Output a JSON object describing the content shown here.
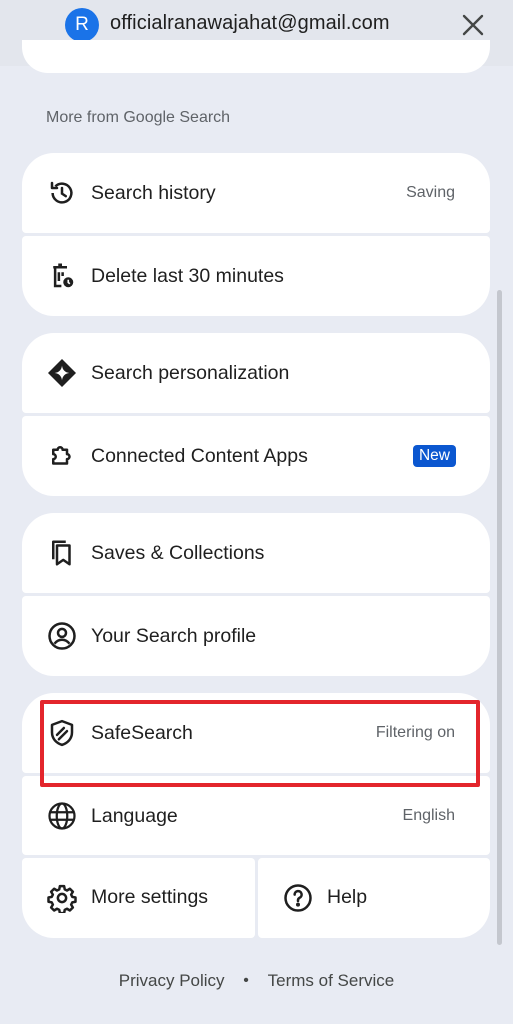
{
  "account": {
    "avatar_letter": "R",
    "email": "officialranawajahat@gmail.com"
  },
  "section_label": "More from Google Search",
  "items": {
    "search_history": {
      "label": "Search history",
      "value": "Saving",
      "icon": "history-icon"
    },
    "delete_last": {
      "label": "Delete last 30 minutes",
      "icon": "delete-clock-icon"
    },
    "personalization": {
      "label": "Search personalization",
      "icon": "diamond-sparkle-icon"
    },
    "connected_apps": {
      "label": "Connected Content Apps",
      "badge": "New",
      "icon": "puzzle-icon"
    },
    "saves": {
      "label": "Saves & Collections",
      "icon": "bookmarks-icon"
    },
    "profile": {
      "label": "Your Search profile",
      "icon": "account-circle-icon"
    },
    "safesearch": {
      "label": "SafeSearch",
      "value": "Filtering on",
      "icon": "shield-icon"
    },
    "language": {
      "label": "Language",
      "value": "English",
      "icon": "globe-icon"
    },
    "more_settings": {
      "label": "More settings",
      "icon": "gear-icon"
    },
    "help": {
      "label": "Help",
      "icon": "help-circle-icon"
    }
  },
  "footer": {
    "privacy": "Privacy Policy",
    "separator": "•",
    "terms": "Terms of Service"
  },
  "colors": {
    "background": "#e8ebf3",
    "card": "#ffffff",
    "accent_badge": "#0b57d0",
    "highlight": "#e3252c",
    "avatar": "#1a73e8"
  }
}
